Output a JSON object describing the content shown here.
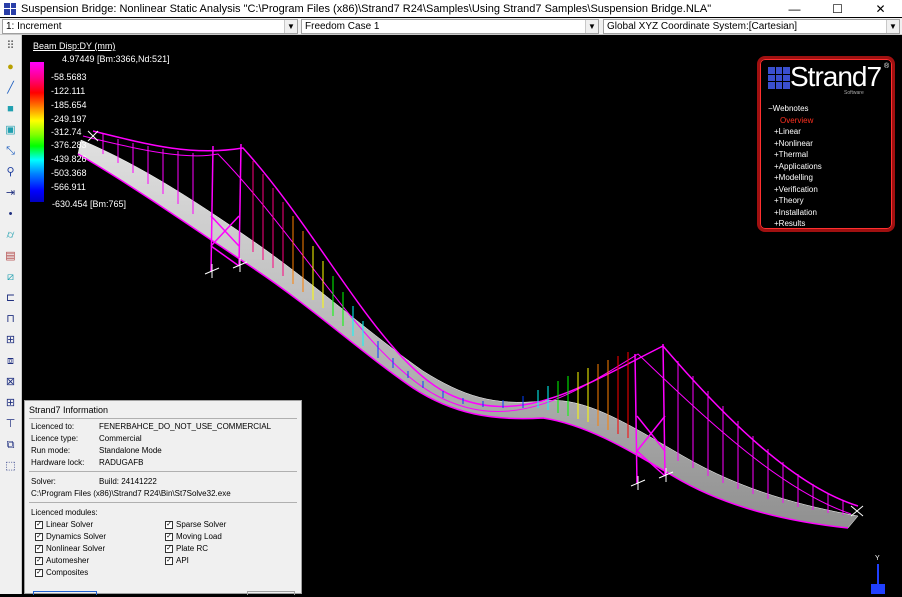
{
  "window": {
    "title": "Suspension Bridge: Nonlinear Static Analysis \"C:\\Program Files (x86)\\Strand7 R24\\Samples\\Using Strand7 Samples\\Suspension Bridge.NLA\"",
    "minimize": "—",
    "maximize": "☐",
    "close": "✕"
  },
  "combos": {
    "increment": "1: Increment",
    "freedom_case": "Freedom Case 1",
    "coordinate_system": "Global XYZ Coordinate System:[Cartesian]"
  },
  "legend": {
    "title": "Beam Disp:DY  (mm)",
    "max": "4.97449 [Bm:3366,Nd:521]",
    "min": "-630.454 [Bm:765]",
    "ticks": [
      "-58.5683",
      "-122.111",
      "-185.654",
      "-249.197",
      "-312.74",
      "-376.283",
      "-439.826",
      "-503.368",
      "-566.911"
    ]
  },
  "webnotes": {
    "logo": "Strand7",
    "logo_reg": "®",
    "logo_sub": "Software",
    "header": "Webnotes",
    "items": [
      {
        "label": "Overview",
        "selected": true
      },
      {
        "label": "Linear"
      },
      {
        "label": "Nonlinear"
      },
      {
        "label": "Thermal"
      },
      {
        "label": "Applications"
      },
      {
        "label": "Modelling"
      },
      {
        "label": "Verification"
      },
      {
        "label": "Theory"
      },
      {
        "label": "Installation"
      },
      {
        "label": "Results"
      }
    ]
  },
  "info": {
    "title": "Strand7 Information",
    "licenced_to_label": "Licenced to:",
    "licenced_to": "FENERBAHCE_DO_NOT_USE_COMMERCIAL",
    "licence_type_label": "Licence type:",
    "licence_type": "Commercial",
    "run_mode_label": "Run mode:",
    "run_mode": "Standalone Mode",
    "hardware_lock_label": "Hardware lock:",
    "hardware_lock": "RADUGAFB",
    "solver_label": "Solver:",
    "build": "Build: 24141222",
    "solver_path": "C:\\Program Files (x86)\\Strand7 R24\\Bin\\St7Solve32.exe",
    "modules_label": "Licenced modules:",
    "modules_left": [
      "Linear Solver",
      "Dynamics Solver",
      "Nonlinear Solver",
      "Automesher",
      "Composites"
    ],
    "modules_right": [
      "Sparse Solver",
      "Moving Load",
      "Plate RC",
      "API"
    ]
  },
  "axis": {
    "y": "Y"
  },
  "colors": {
    "magenta": "#ff00ff",
    "red": "#ff0000",
    "yellow": "#ffff00",
    "green": "#00ff00",
    "cyan": "#00ffff",
    "blue": "#0000ff",
    "deck": "#c8c8c8",
    "webnotes_border": "#a01010"
  }
}
